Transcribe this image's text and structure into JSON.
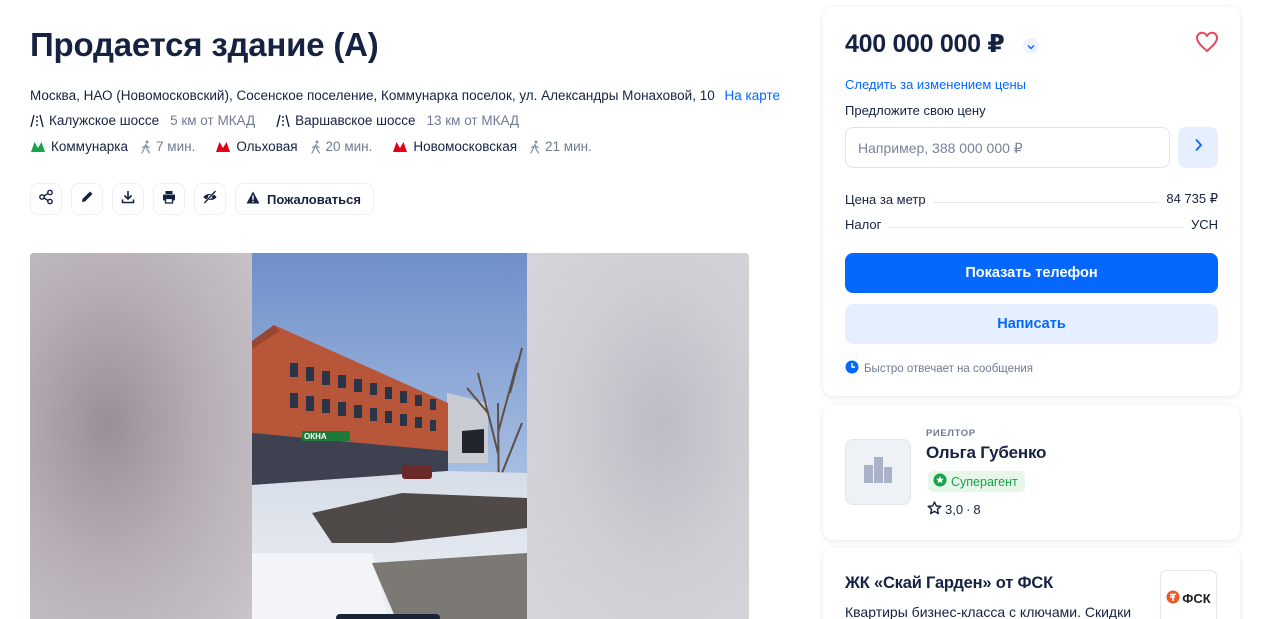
{
  "listing": {
    "title": "Продается здание (А)",
    "address": "Москва, НАО (Новомосковский), Сосенское поселение, Коммунарка поселок, ул. Александры Монаховой, 10",
    "map_link": "На карте",
    "highways": [
      {
        "name": "Калужское шоссе",
        "distance": "5 км от МКАД",
        "icon": "highway-icon"
      },
      {
        "name": "Варшавское шоссе",
        "distance": "13 км от МКАД",
        "icon": "highway-icon"
      }
    ],
    "metro": [
      {
        "name": "Коммунарка",
        "walk": "7 мин.",
        "color": "#1aa34a",
        "icon": "metro-icon"
      },
      {
        "name": "Ольховая",
        "walk": "20 мин.",
        "color": "#e3001b",
        "icon": "metro-icon"
      },
      {
        "name": "Новомосковская",
        "walk": "21 мин.",
        "color": "#e3001b",
        "icon": "metro-icon"
      }
    ],
    "toolbar": {
      "icons": [
        "share-icon",
        "edit-icon",
        "download-icon",
        "print-icon",
        "hide-icon"
      ],
      "complain_label": "Пожаловаться"
    }
  },
  "sidebar": {
    "price": "400 000 000 ₽",
    "track_price": "Следить за изменением цены",
    "offer_label": "Предложите свою цену",
    "offer_placeholder": "Например, 388 000 000 ₽",
    "price_per_meter_label": "Цена за метр",
    "price_per_meter_value": "84 735 ₽",
    "tax_label": "Налог",
    "tax_value": "УСН",
    "show_phone": "Показать телефон",
    "write": "Написать",
    "fast_reply": "Быстро отвечает на сообщения"
  },
  "agent": {
    "role": "РИЕЛТОР",
    "name": "Ольга Губенко",
    "badge": "Суперагент",
    "rating": "3,0",
    "reviews": "8"
  },
  "promo": {
    "title": "ЖК «Скай Гарден» от ФСК",
    "text": "Квартиры бизнес-класса с ключами. Скидки",
    "logo_text": "ФСК"
  },
  "colors": {
    "accent": "#0468ff",
    "accent_light": "#e6efff",
    "text": "#152242",
    "muted": "#707a95",
    "favorite": "#e8485a",
    "success": "#16a34a"
  }
}
